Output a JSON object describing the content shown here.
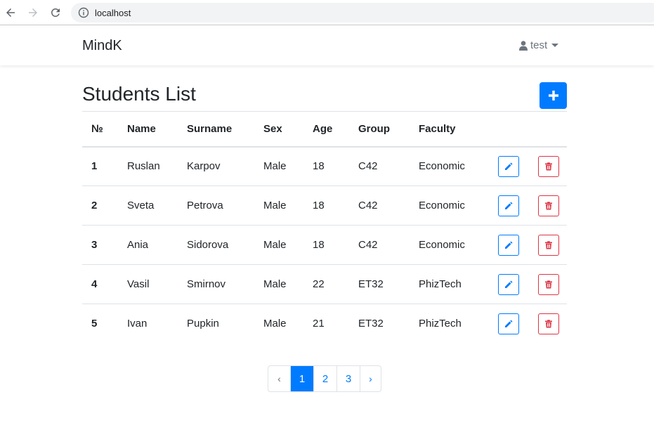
{
  "browser": {
    "url": "localhost"
  },
  "navbar": {
    "brand": "MindK",
    "user": "test"
  },
  "main": {
    "title": "Students List",
    "columns": [
      "№",
      "Name",
      "Surname",
      "Sex",
      "Age",
      "Group",
      "Faculty"
    ],
    "rows": [
      [
        "1",
        "Ruslan",
        "Karpov",
        "Male",
        "18",
        "C42",
        "Economic"
      ],
      [
        "2",
        "Sveta",
        "Petrova",
        "Male",
        "18",
        "C42",
        "Economic"
      ],
      [
        "3",
        "Ania",
        "Sidorova",
        "Male",
        "18",
        "C42",
        "Economic"
      ],
      [
        "4",
        "Vasil",
        "Smirnov",
        "Male",
        "22",
        "ET32",
        "PhizTech"
      ],
      [
        "5",
        "Ivan",
        "Pupkin",
        "Male",
        "21",
        "ET32",
        "PhizTech"
      ]
    ]
  },
  "pagination": {
    "prev": "‹",
    "pages": [
      "1",
      "2",
      "3"
    ],
    "active": "1",
    "next": "›"
  },
  "colors": {
    "primary": "#007bff",
    "danger": "#dc3545",
    "muted": "#6c757d"
  },
  "icons": {
    "back": "arrow-left-icon",
    "forward": "arrow-right-icon",
    "reload": "reload-icon",
    "info": "info-icon",
    "user": "user-icon",
    "add": "plus-icon",
    "edit": "pencil-icon",
    "delete": "trash-icon"
  }
}
